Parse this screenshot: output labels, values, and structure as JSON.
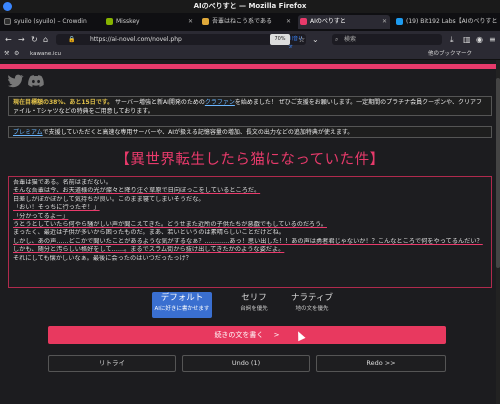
{
  "window": {
    "title": "AIのべりすと — Mozilla Firefox"
  },
  "tabs": [
    {
      "label": "syuilo (syuilo) – Crowdin",
      "color": "#2e2e2e"
    },
    {
      "label": "Misskey",
      "color": "#86b300"
    },
    {
      "label": "吾輩はねこう系である",
      "color": "#e0a93a"
    },
    {
      "label": "AIのべりすと",
      "color": "#e83a6b"
    },
    {
      "label": "(19) Bit192 Labs【AIのべりすと",
      "color": "#1d9bf0"
    }
  ],
  "nav": {
    "url_prefix": "🔒",
    "url": "https://ai-novel.com/novel.php",
    "badge": "川音リオ",
    "zoom": "70%",
    "search_placeholder": "検索"
  },
  "bookmarks": {
    "item": "kawane.icu",
    "other": "他のブックマーク"
  },
  "notices": {
    "n1_a": "現在目標額の38%、あと15日です。",
    "n1_b": " サーバー増強と新AI開発のためのクラファンを始めました！ ぜひご支援をお願いします。一定期間のプラチナ会員クーポンや、クリアファイル・Tシャツなどの特典をご用意しております。",
    "n1_link": "クラファン",
    "n2_link": "プレミアム",
    "n2_b": "で支援していただくと高速な専用サーバーや、AIが扱える記憶容量の増加、長文の出力などの追加特典が使えます。"
  },
  "story": {
    "title": "【異世界転生したら猫になっていた件】",
    "lines": [
      "吾輩は猫である。名前はまだない。",
      "そんな吾輩は今、お天道様の光が燦々と降り注ぐ草原で日向ぼっこをしているところだ。",
      "日差しがぽかぽかして気持ちが良い。このまま寝てしまいそうだな。",
      "「おい！そっちに行ったぞ！」",
      "「分かってるよー」",
      "うとうとしていたら何やら騒がしい声が聞こえてきた。どうせまた近所の子供たちが悪戯でもしているのだろう。",
      "まったく、最近は子供が多いから困ったものだ。まあ、若いというのは素晴らしいことだけどね。",
      "しかし、あの声……どこかで聞いたことがあるような気がするなぁ？…………あっ！思い出した！！あの声は勇者君じゃないか！？こんなところで何をやってるんだい？",
      "しかも、随分と汚らしい格好をして……。まるでスラム街から抜け出してきたかのような姿だよ。",
      "それにしても懐かしいなぁ。最後に会ったのはいつだったっけ？"
    ]
  },
  "modes": [
    {
      "title": "デフォルト",
      "sub": "AIに好きに書かせます"
    },
    {
      "title": "セリフ",
      "sub": "台詞を優先"
    },
    {
      "title": "ナラティブ",
      "sub": "地の文を優先"
    }
  ],
  "actions": {
    "continue": "続きの文を書く",
    "continue_arrow": ">",
    "retry": "リトライ",
    "undo": "Undo (1)",
    "redo": "Redo >>"
  },
  "colors": {
    "accent": "#e83a6b",
    "mode_selected": "#3a6fd0",
    "highlight": "#e2c24a",
    "link": "#6bb6ff"
  }
}
